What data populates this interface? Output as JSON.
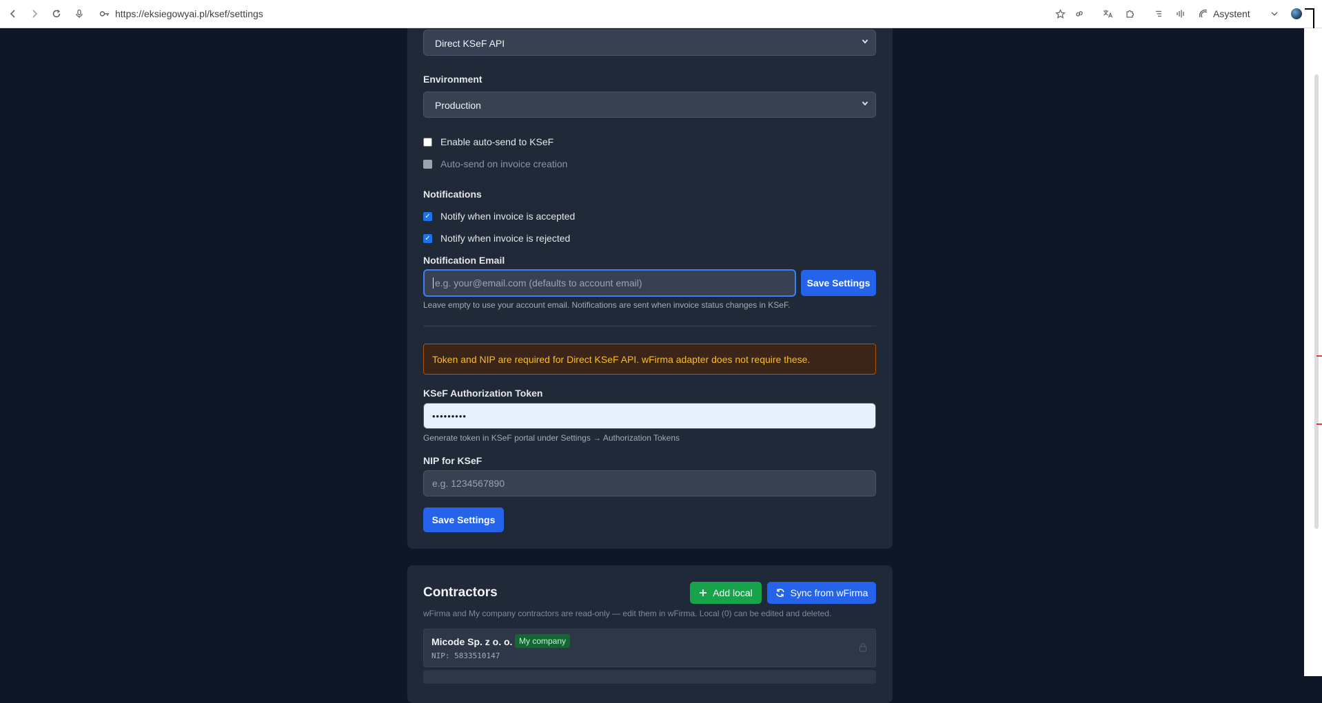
{
  "browser": {
    "url": "https://eksiegowyai.pl/ksef/settings",
    "assistant_label": "Asystent"
  },
  "settings": {
    "adapter_select_value": "Direct KSeF API",
    "environment_label": "Environment",
    "environment_value": "Production",
    "auto_send_label": "Enable auto-send to KSeF",
    "auto_send_on_create_label": "Auto-send on invoice creation",
    "notifications_heading": "Notifications",
    "notify_accepted_label": "Notify when invoice is accepted",
    "notify_rejected_label": "Notify when invoice is rejected",
    "notification_email_label": "Notification Email",
    "notification_email_placeholder": "e.g. your@email.com (defaults to account email)",
    "save_settings_label": "Save Settings",
    "notification_email_help": "Leave empty to use your account email. Notifications are sent when invoice status changes in KSeF.",
    "warning_text": "Token and NIP are required for Direct KSeF API. wFirma adapter does not require these.",
    "token_label": "KSeF Authorization Token",
    "token_value": "•••••••••",
    "token_help": "Generate token in KSeF portal under Settings → Authorization Tokens",
    "nip_label": "NIP for KSeF",
    "nip_placeholder": "e.g. 1234567890",
    "save_settings_bottom_label": "Save Settings"
  },
  "contractors": {
    "heading": "Contractors",
    "add_local_label": "Add local",
    "sync_label": "Sync from wFirma",
    "help": "wFirma and My company contractors are read-only — edit them in wFirma. Local (0) can be edited and deleted.",
    "items": [
      {
        "name": "Micode Sp. z o. o.",
        "badge": "My company",
        "nip": "NIP: 5833510147"
      }
    ]
  },
  "colors": {
    "page_bg": "#0f1626",
    "card_bg": "#1f2937",
    "primary": "#2563eb",
    "success": "#16a34a",
    "warning_text": "#fbbf24",
    "warning_border": "#b45309"
  }
}
